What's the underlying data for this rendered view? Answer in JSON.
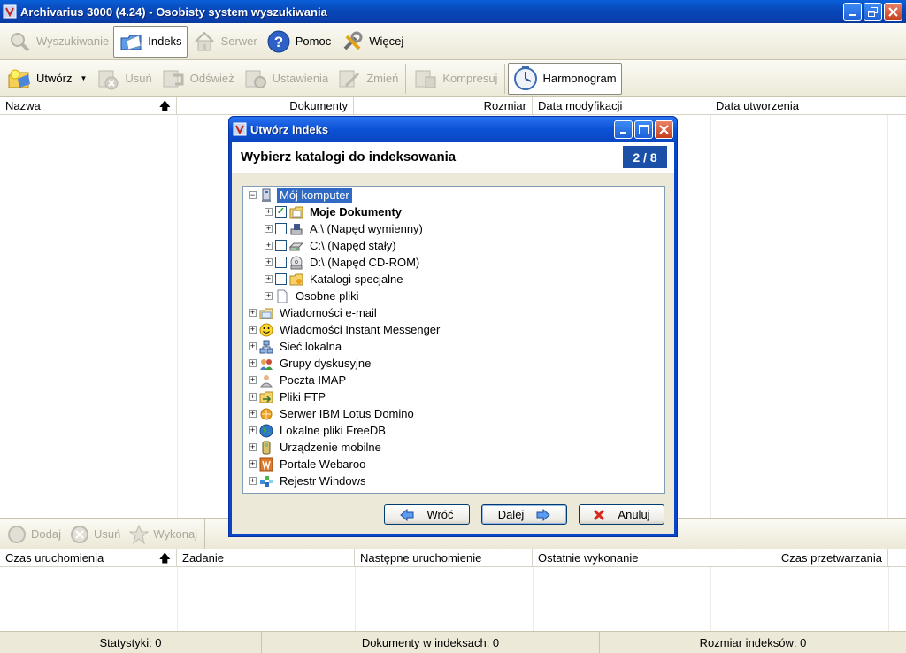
{
  "window": {
    "title": "Archivarius 3000 (4.24) - Osobisty system wyszukiwania"
  },
  "main_toolbar": [
    {
      "label": "Wyszukiwanie",
      "icon": "magnifier-icon",
      "state": "disabled"
    },
    {
      "label": "Indeks",
      "icon": "index-folder-icon",
      "state": "active"
    },
    {
      "label": "Serwer",
      "icon": "house-icon",
      "state": "disabled"
    },
    {
      "label": "Pomoc",
      "icon": "help-icon",
      "state": "normal"
    },
    {
      "label": "Więcej",
      "icon": "tools-icon",
      "state": "normal"
    }
  ],
  "index_toolbar": [
    {
      "label": "Utwórz",
      "icon": "create-index-icon",
      "state": "normal",
      "dropdown": true
    },
    {
      "label": "Usuń",
      "icon": "delete-icon",
      "state": "disabled"
    },
    {
      "label": "Odśwież",
      "icon": "refresh-icon",
      "state": "disabled"
    },
    {
      "label": "Ustawienia",
      "icon": "settings-icon",
      "state": "disabled"
    },
    {
      "label": "Zmień",
      "icon": "modify-icon",
      "state": "disabled"
    },
    {
      "label": "Kompresuj",
      "icon": "compress-icon",
      "state": "disabled"
    },
    {
      "label": "Harmonogram",
      "icon": "clock-icon",
      "state": "active"
    }
  ],
  "index_list": {
    "columns": [
      "Nazwa",
      "Dokumenty",
      "Rozmiar",
      "Data modyfikacji",
      "Data utworzenia"
    ]
  },
  "schedule_toolbar": [
    {
      "label": "Dodaj",
      "icon": "add-icon",
      "state": "disabled"
    },
    {
      "label": "Usuń",
      "icon": "remove-icon",
      "state": "disabled"
    },
    {
      "label": "Wykonaj",
      "icon": "run-icon",
      "state": "disabled"
    }
  ],
  "schedule_list": {
    "columns": [
      "Czas uruchomienia",
      "Zadanie",
      "Następne uruchomienie",
      "Ostatnie wykonanie",
      "Czas przetwarzania"
    ]
  },
  "statusbar": {
    "stats": "Statystyki: 0",
    "documents": "Dokumenty w indeksach: 0",
    "size": "Rozmiar indeksów: 0"
  },
  "dialog": {
    "title": "Utwórz indeks",
    "heading": "Wybierz katalogi do indeksowania",
    "step": "2 / 8",
    "tree": [
      {
        "label": "Mój komputer",
        "level": 0,
        "expander": "−",
        "icon": "computer-icon",
        "selected": true
      },
      {
        "label": "Moje Dokumenty",
        "level": 1,
        "expander": "+",
        "checkbox": "checked",
        "icon": "documents-folder-icon",
        "bold": true
      },
      {
        "label": "A:\\ (Napęd wymienny)",
        "level": 1,
        "expander": "+",
        "checkbox": "unchecked",
        "icon": "floppy-drive-icon"
      },
      {
        "label": "C:\\ (Napęd stały)",
        "level": 1,
        "expander": "+",
        "checkbox": "unchecked",
        "icon": "hard-drive-icon"
      },
      {
        "label": "D:\\ (Napęd CD-ROM)",
        "level": 1,
        "expander": "+",
        "checkbox": "unchecked",
        "icon": "cdrom-drive-icon"
      },
      {
        "label": "Katalogi specjalne",
        "level": 1,
        "expander": "+",
        "checkbox": "unchecked",
        "icon": "special-folder-icon"
      },
      {
        "label": "Osobne pliki",
        "level": 1,
        "expander": "+",
        "icon": "file-icon"
      },
      {
        "label": "Wiadomości e-mail",
        "level": 0,
        "expander": "+",
        "icon": "email-icon"
      },
      {
        "label": "Wiadomości Instant Messenger",
        "level": 0,
        "expander": "+",
        "icon": "smiley-icon"
      },
      {
        "label": "Sieć lokalna",
        "level": 0,
        "expander": "+",
        "icon": "network-icon"
      },
      {
        "label": "Grupy dyskusyjne",
        "level": 0,
        "expander": "+",
        "icon": "newsgroups-icon"
      },
      {
        "label": "Poczta IMAP",
        "level": 0,
        "expander": "+",
        "icon": "imap-mail-icon"
      },
      {
        "label": "Pliki FTP",
        "level": 0,
        "expander": "+",
        "icon": "ftp-icon"
      },
      {
        "label": "Serwer IBM Lotus Domino",
        "level": 0,
        "expander": "+",
        "icon": "lotus-domino-icon"
      },
      {
        "label": "Lokalne pliki FreeDB",
        "level": 0,
        "expander": "+",
        "icon": "freedb-globe-icon"
      },
      {
        "label": "Urządzenie mobilne",
        "level": 0,
        "expander": "+",
        "icon": "mobile-device-icon"
      },
      {
        "label": "Portale Webaroo",
        "level": 0,
        "expander": "+",
        "icon": "webaroo-icon"
      },
      {
        "label": "Rejestr Windows",
        "level": 0,
        "expander": "+",
        "icon": "registry-icon"
      }
    ],
    "buttons": {
      "back": "Wróć",
      "next": "Dalej",
      "cancel": "Anuluj"
    }
  },
  "colors": {
    "titlebar_blue": "#0a47c2",
    "selection": "#316ac5",
    "step_badge": "#1b4fa8",
    "xp_face": "#ece9d8"
  }
}
